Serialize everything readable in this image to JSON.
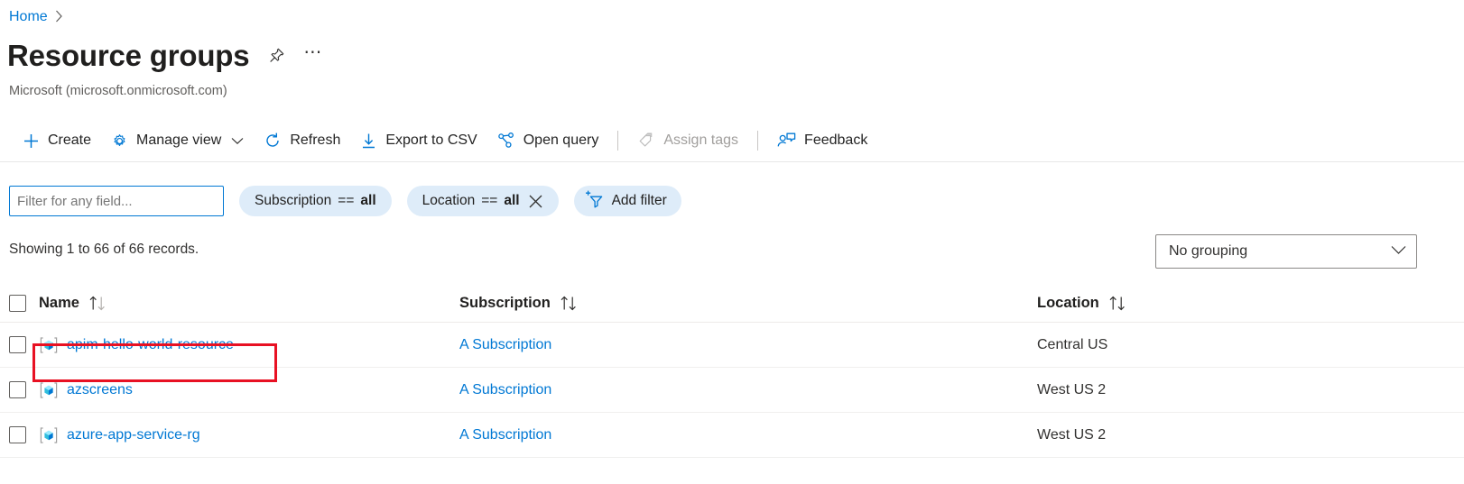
{
  "breadcrumb": {
    "home": "Home",
    "separator": "›"
  },
  "header": {
    "title": "Resource groups",
    "subtitle": "Microsoft (microsoft.onmicrosoft.com)",
    "pin_icon": "pin-icon",
    "more_icon": "ellipsis-icon"
  },
  "toolbar": {
    "create": "Create",
    "manage_view": "Manage view",
    "refresh": "Refresh",
    "export_csv": "Export to CSV",
    "open_query": "Open query",
    "assign_tags": "Assign tags",
    "feedback": "Feedback",
    "icons": {
      "create": "plus-icon",
      "manage_view": "gear-icon",
      "manage_view_chevron": "chevron-down-icon",
      "refresh": "refresh-icon",
      "export_csv": "download-icon",
      "open_query": "query-graph-icon",
      "assign_tags": "tags-icon",
      "feedback": "feedback-person-icon"
    }
  },
  "filters": {
    "search_placeholder": "Filter for any field...",
    "search_value": "",
    "subscription": {
      "label": "Subscription",
      "operator": "==",
      "value": "all"
    },
    "location": {
      "label": "Location",
      "operator": "==",
      "value": "all",
      "clear_icon": "close-icon"
    },
    "add_filter": {
      "label": "Add filter",
      "icon": "add-filter-icon"
    }
  },
  "summary": {
    "records_text": "Showing 1 to 66 of 66 records.",
    "grouping_value": "No grouping",
    "grouping_chevron": "chevron-down-icon"
  },
  "table": {
    "columns": [
      {
        "label": "Name",
        "sort_icon": "sort-arrows-icon"
      },
      {
        "label": "Subscription",
        "sort_icon": "sort-arrows-icon"
      },
      {
        "label": "Location",
        "sort_icon": "sort-arrows-icon"
      }
    ],
    "rows": [
      {
        "name": "apim-hello-world-resource",
        "subscription": "A Subscription",
        "location": "Central US",
        "icon": "resource-group-icon",
        "highlighted": true
      },
      {
        "name": "azscreens",
        "subscription": "A Subscription",
        "location": "West US 2",
        "icon": "resource-group-icon",
        "highlighted": false
      },
      {
        "name": "azure-app-service-rg",
        "subscription": "A Subscription",
        "location": "West US 2",
        "icon": "resource-group-icon",
        "highlighted": false
      }
    ]
  },
  "colors": {
    "accent": "#0078d4",
    "highlight": "#e81123",
    "pill_bg": "#deecf9",
    "text": "#323130"
  }
}
